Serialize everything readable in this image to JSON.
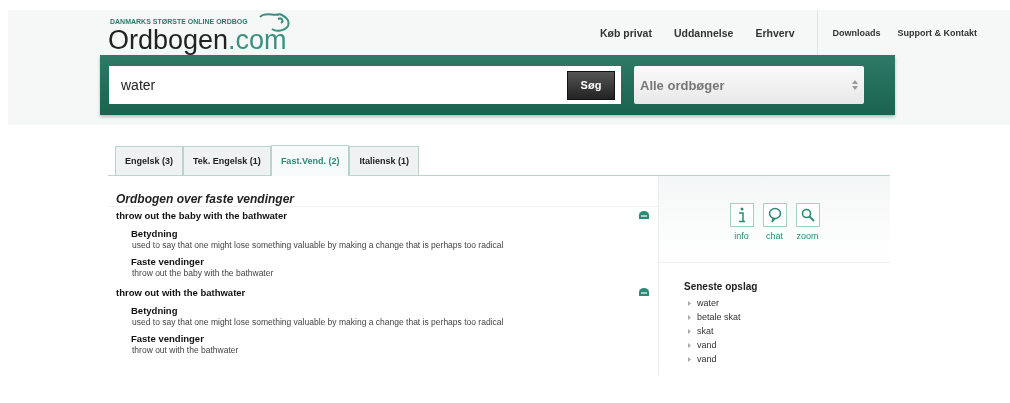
{
  "logo": {
    "tagline": "DANMARKS STØRSTE ONLINE ORDBOG",
    "name": "Ordbogen",
    "suffix": ".com"
  },
  "nav": {
    "main": [
      "Køb privat",
      "Uddannelse",
      "Erhverv"
    ],
    "secondary": [
      "Downloads",
      "Support & Kontakt"
    ]
  },
  "search": {
    "value": "water",
    "button": "Søg",
    "dictionary": "Alle ordbøger"
  },
  "tabs": [
    {
      "label": "Engelsk",
      "count": "(3)",
      "selected": false
    },
    {
      "label": "Tek. Engelsk",
      "count": "(1)",
      "selected": false
    },
    {
      "label": "Fast.Vend.",
      "count": "(2)",
      "selected": true
    },
    {
      "label": "Italiensk",
      "count": "(1)",
      "selected": false
    }
  ],
  "results": {
    "title": "Ordbogen over faste vendinger",
    "entries": [
      {
        "headword": "throw out the baby with the bathwater",
        "sections": [
          {
            "heading": "Betydning",
            "text": "used to say that one might lose something valuable by making a change that is perhaps too radical"
          },
          {
            "heading": "Faste vendinger",
            "text": "throw out the baby with the bathwater"
          }
        ]
      },
      {
        "headword": "throw out with the bathwater",
        "sections": [
          {
            "heading": "Betydning",
            "text": "used to say that one might lose something valuable by making a change that is perhaps too radical"
          },
          {
            "heading": "Faste vendinger",
            "text": "throw out with the bathwater"
          }
        ]
      }
    ]
  },
  "tools": [
    {
      "kind": "info",
      "label": "info"
    },
    {
      "kind": "chat",
      "label": "chat"
    },
    {
      "kind": "zoom",
      "label": "zoom"
    }
  ],
  "recent": {
    "title": "Seneste opslag",
    "items": [
      "water",
      "betale skat",
      "skat",
      "vand",
      "vand"
    ]
  }
}
